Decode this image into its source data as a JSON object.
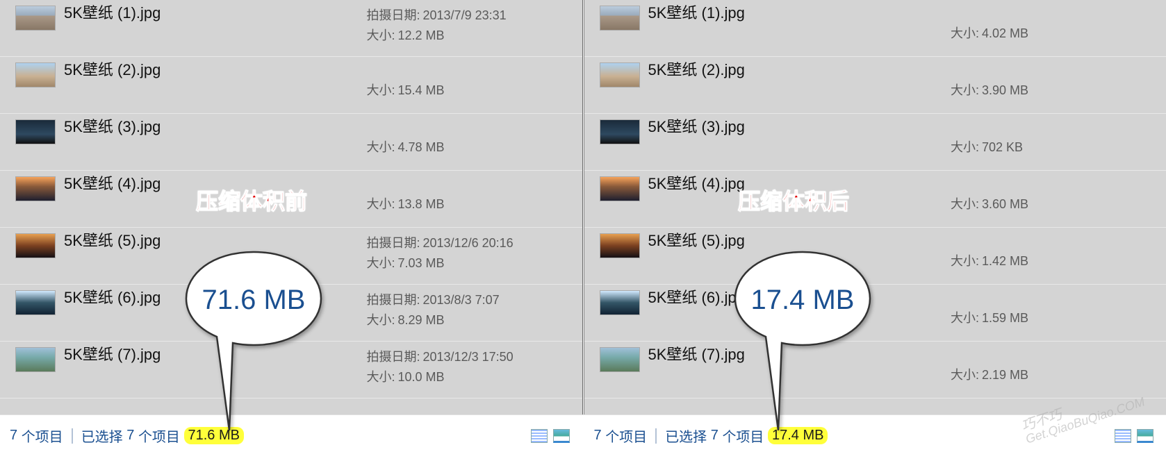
{
  "labels": {
    "date_taken": "拍摄日期:",
    "size": "大小:",
    "items_suffix": "个项目",
    "selected_prefix": "已选择",
    "selected_suffix": "个项目"
  },
  "annotations": {
    "before": "压缩体积前",
    "after": "压缩体积后",
    "bubble_before": "71.6 MB",
    "bubble_after": "17.4 MB"
  },
  "left": {
    "files": [
      {
        "name": "5K壁纸 (1).jpg",
        "date": "2013/7/9 23:31",
        "size": "12.2 MB",
        "thumb": "t1"
      },
      {
        "name": "5K壁纸 (2).jpg",
        "date": "",
        "size": "15.4 MB",
        "thumb": "t2"
      },
      {
        "name": "5K壁纸 (3).jpg",
        "date": "",
        "size": "4.78 MB",
        "thumb": "t3"
      },
      {
        "name": "5K壁纸 (4).jpg",
        "date": "",
        "size": "13.8 MB",
        "thumb": "t4"
      },
      {
        "name": "5K壁纸 (5).jpg",
        "date": "2013/12/6 20:16",
        "size": "7.03 MB",
        "thumb": "t5"
      },
      {
        "name": "5K壁纸 (6).jpg",
        "date": "2013/8/3 7:07",
        "size": "8.29 MB",
        "thumb": "t6"
      },
      {
        "name": "5K壁纸 (7).jpg",
        "date": "2013/12/3 17:50",
        "size": "10.0 MB",
        "thumb": "t7"
      }
    ],
    "status": {
      "count": "7",
      "selected": "7",
      "total_size": "71.6 MB"
    }
  },
  "right": {
    "files": [
      {
        "name": "5K壁纸 (1).jpg",
        "date": "",
        "size": "4.02 MB",
        "thumb": "t1"
      },
      {
        "name": "5K壁纸 (2).jpg",
        "date": "",
        "size": "3.90 MB",
        "thumb": "t2"
      },
      {
        "name": "5K壁纸 (3).jpg",
        "date": "",
        "size": "702 KB",
        "thumb": "t3"
      },
      {
        "name": "5K壁纸 (4).jpg",
        "date": "",
        "size": "3.60 MB",
        "thumb": "t4"
      },
      {
        "name": "5K壁纸 (5).jpg",
        "date": "",
        "size": "1.42 MB",
        "thumb": "t5"
      },
      {
        "name": "5K壁纸 (6).jpg",
        "date": "",
        "size": "1.59 MB",
        "thumb": "t6"
      },
      {
        "name": "5K壁纸 (7).jpg",
        "date": "",
        "size": "2.19 MB",
        "thumb": "t7"
      }
    ],
    "status": {
      "count": "7",
      "selected": "7",
      "total_size": "17.4 MB"
    }
  },
  "watermark": {
    "line1": "巧不巧",
    "line2": "Get.QiaoBuQiao.COM"
  }
}
